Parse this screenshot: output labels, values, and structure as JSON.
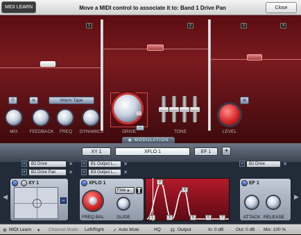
{
  "topbar": {
    "midi_learn_label": "MIDI LEARN",
    "message": "Move a MIDI control to associate it to: Band 1 Drive Pan",
    "close_label": "Close"
  },
  "bands": {
    "numbers": [
      "1",
      "2",
      "3",
      "4"
    ]
  },
  "controls": {
    "mix_label": "MIX",
    "feedback_label": "FEEDBACK",
    "freq_label": "FREQ",
    "dynamics_label": "DYNAMICS",
    "drive_label": "DRIVE",
    "tone_label": "TONE",
    "level_label": "LEVEL",
    "drive_type": "Warm Tape",
    "drive_pan_tab": "−"
  },
  "modulation": {
    "strip_label": "MODULATION",
    "tabs": [
      "XY 1",
      "XFLO 1",
      "EF 1"
    ],
    "active_tab": "XFLO 1",
    "add_label": "+",
    "xy_slots": [
      "B2 Drive",
      "B2 Drive Pan"
    ],
    "xflo_slots": [
      "B1 Output L...",
      "B3 Output L..."
    ],
    "ef_slots": [
      "B2 Drive"
    ]
  },
  "xy_box": {
    "title": "XY 1"
  },
  "xflo_box": {
    "title": "XFLO 1",
    "mode": "Free",
    "freq_label": "FREQ",
    "bal_label": "BAL",
    "glide_label": "GLIDE",
    "step_numbers": [
      "1",
      "2",
      "3",
      "4",
      "5",
      "6",
      "7"
    ]
  },
  "ef_box": {
    "title": "EF 1",
    "attack_label": "ATTACK",
    "release_label": "RELEASE"
  },
  "footer": {
    "midi_learn": "MIDI Learn",
    "channel_mode_label": "Channel Mode:",
    "channel_mode_value": "Left/Right",
    "auto_mute": "Auto Mute",
    "hq": "HQ",
    "output": "Output",
    "in_level": "In: 0 dB",
    "out_level": "Out: 0 dB",
    "mix": "Mix: 100 %"
  },
  "colors": {
    "accent_red": "#d62828",
    "panel_blue": "#222b38"
  }
}
